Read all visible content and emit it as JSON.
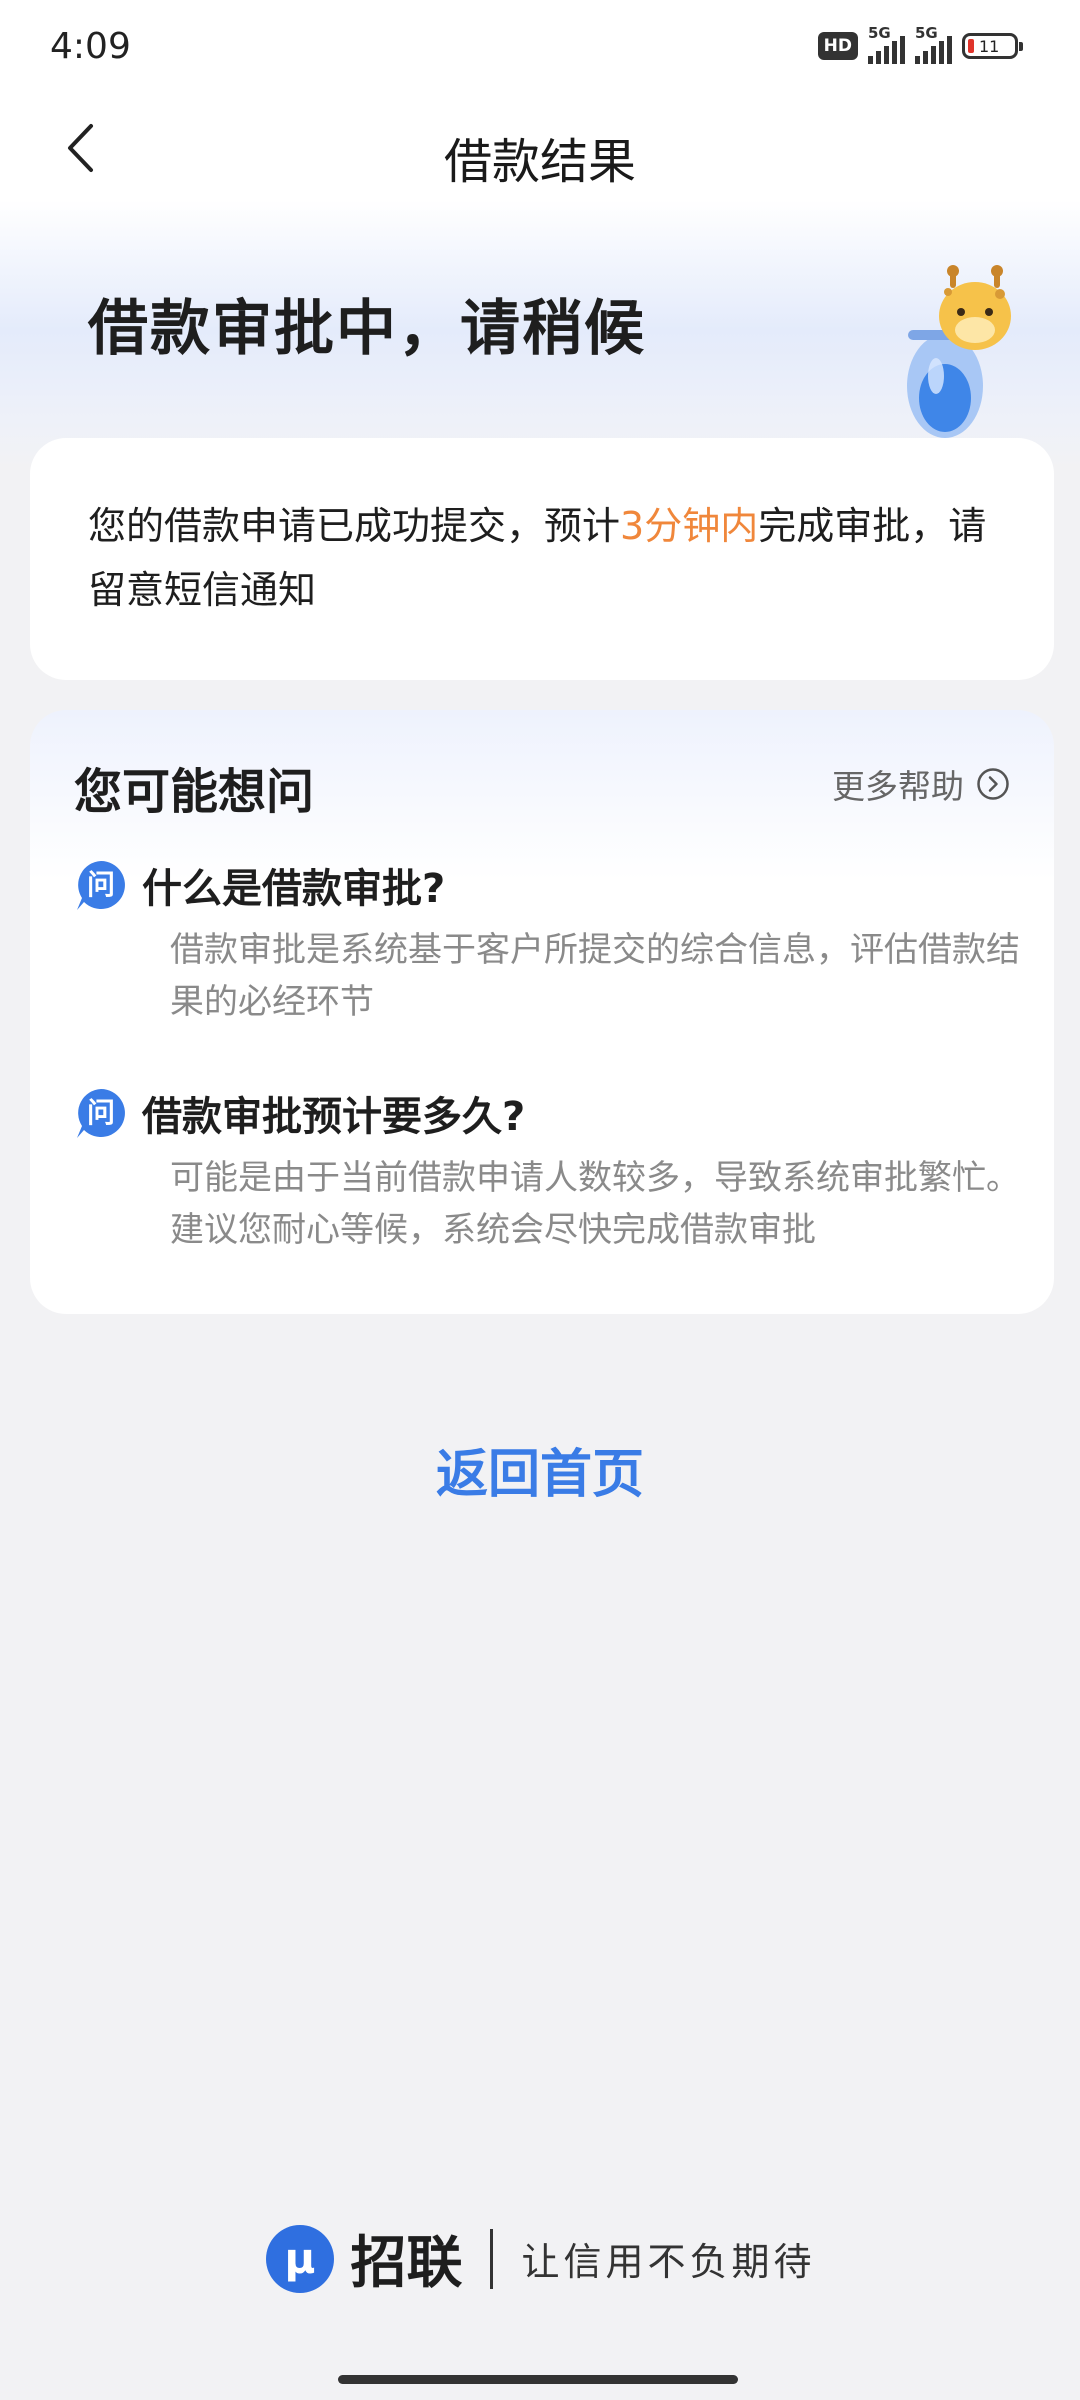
{
  "status_bar": {
    "time": "4:09",
    "hd_label": "HD",
    "signal_1_label": "5G",
    "signal_2_label": "5G",
    "battery_level": "11",
    "battery_color": "#e0342b"
  },
  "nav": {
    "title": "借款结果",
    "back_icon": "chevron-left-icon"
  },
  "status": {
    "heading": "借款审批中，请稍候",
    "mascot": "giraffe-hourglass-mascot"
  },
  "info_card": {
    "text_before": "您的借款申请已成功提交，预计",
    "highlight": "3分钟内",
    "text_after": "完成审批，请留意短信通知",
    "highlight_color": "#f0873b"
  },
  "faq": {
    "title": "您可能想问",
    "more_help": "更多帮助",
    "more_help_icon": "circle-chevron-right-icon",
    "question_icon": "question-bubble-icon",
    "question_icon_label": "问",
    "items": [
      {
        "question": "什么是借款审批?",
        "answer": "借款审批是系统基于客户所提交的综合信息，评估借款结果的必经环节"
      },
      {
        "question": "借款审批预计要多久?",
        "answer": "可能是由于当前借款申请人数较多，导致系统审批繁忙。建议您耐心等候，系统会尽快完成借款审批"
      }
    ]
  },
  "actions": {
    "home_label": "返回首页",
    "accent_color": "#3a7ce6"
  },
  "footer": {
    "logo_letter": "μ",
    "brand": "招联",
    "slogan": "让信用不负期待"
  }
}
